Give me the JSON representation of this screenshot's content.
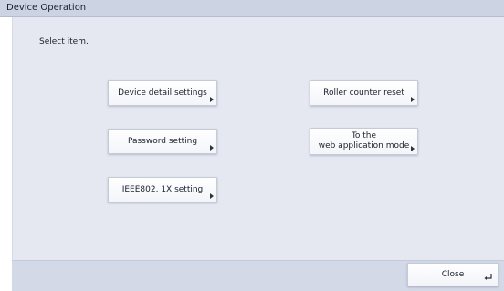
{
  "window": {
    "title": "Device Operation"
  },
  "main": {
    "instruction": "Select item.",
    "buttons": [
      {
        "label": "Device detail settings",
        "icon": "chevron-right-icon"
      },
      {
        "label": "Roller counter reset",
        "icon": "chevron-right-icon"
      },
      {
        "label": "Password setting",
        "icon": "chevron-right-icon"
      },
      {
        "label": "To the\nweb application mode",
        "icon": "chevron-right-icon"
      },
      {
        "label": "IEEE802. 1X setting",
        "icon": "chevron-right-icon"
      }
    ]
  },
  "footer": {
    "close_label": "Close",
    "close_icon": "return-icon"
  },
  "colors": {
    "titlebar": "#ccd3e2",
    "panel": "#e5e8f1",
    "footer": "#d3d9e7",
    "button": "#ffffff",
    "text": "#1a1f2b"
  }
}
